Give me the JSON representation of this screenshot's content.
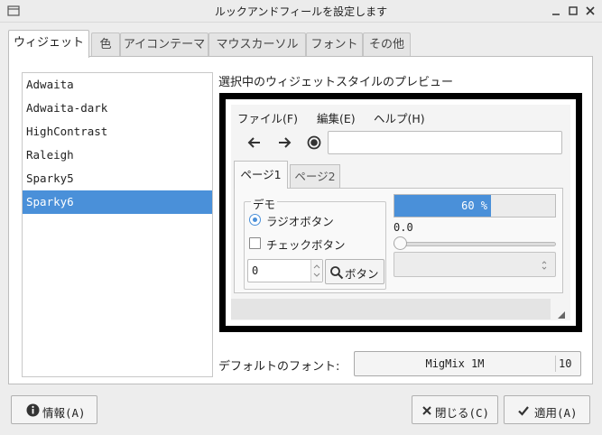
{
  "window": {
    "title": "ルックアンドフィールを設定します"
  },
  "tabs": [
    {
      "label": "ウィジェット",
      "active": true
    },
    {
      "label": "色"
    },
    {
      "label": "アイコンテーマ"
    },
    {
      "label": "マウスカーソル"
    },
    {
      "label": "フォント"
    },
    {
      "label": "その他"
    }
  ],
  "themes": {
    "items": [
      "Adwaita",
      "Adwaita-dark",
      "HighContrast",
      "Raleigh",
      "Sparky5",
      "Sparky6"
    ],
    "selected": "Sparky6"
  },
  "preview": {
    "label": "選択中のウィジェットスタイルのプレビュー",
    "menu": [
      "ファイル(F)",
      "編集(E)",
      "ヘルプ(H)"
    ],
    "toolbar_icons": [
      "back-arrow-icon",
      "forward-arrow-icon",
      "stop-record-icon"
    ],
    "url_value": "",
    "tabs": [
      "ページ1",
      "ページ2"
    ],
    "demo_title": "デモ",
    "radio_label": "ラジオボタン",
    "check_label": "チェックボタン",
    "spin_value": "0",
    "button_label": "ボタン",
    "progress": {
      "fraction": 0.6,
      "text": "60 %"
    },
    "slider": {
      "value_text": "0.0",
      "value": 0.0
    },
    "combo_value": ""
  },
  "font": {
    "label": "デフォルトのフォント:",
    "name": "MigMix 1M",
    "size": "10"
  },
  "buttons": {
    "about": "情報(A)",
    "close": "閉じる(C)",
    "apply": "適用(A)"
  },
  "colors": {
    "accent": "#4a90d9",
    "preview_border": "#000000"
  }
}
